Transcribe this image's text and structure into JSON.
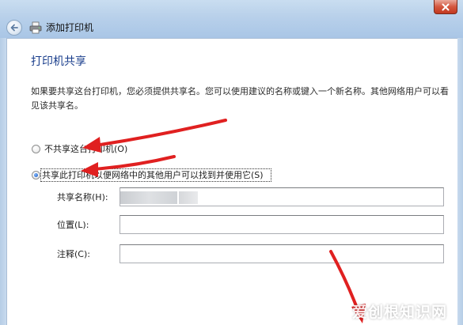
{
  "window": {
    "title": "添加打印机",
    "close_icon": "close-icon",
    "back_icon": "back-arrow-icon",
    "printer_icon": "printer-icon"
  },
  "page": {
    "heading": "打印机共享",
    "description": "如果要共享这台打印机，您必须提供共享名。您可以使用建议的名称或键入一个新名称。其他网络用户可以看见该共享名。"
  },
  "options": {
    "no_share_label": "不共享这台打印机(O)",
    "share_label": "共享此打印机以便网络中的其他用户可以找到并使用它(S)",
    "selected": "share"
  },
  "fields": {
    "share_name_label": "共享名称(H):",
    "share_name_value": "",
    "location_label": "位置(L):",
    "location_value": "",
    "comment_label": "注释(C):",
    "comment_value": ""
  },
  "colors": {
    "heading": "#1a3e8c",
    "annotation_arrow": "#e02020"
  },
  "watermark": "爱创根知识网"
}
